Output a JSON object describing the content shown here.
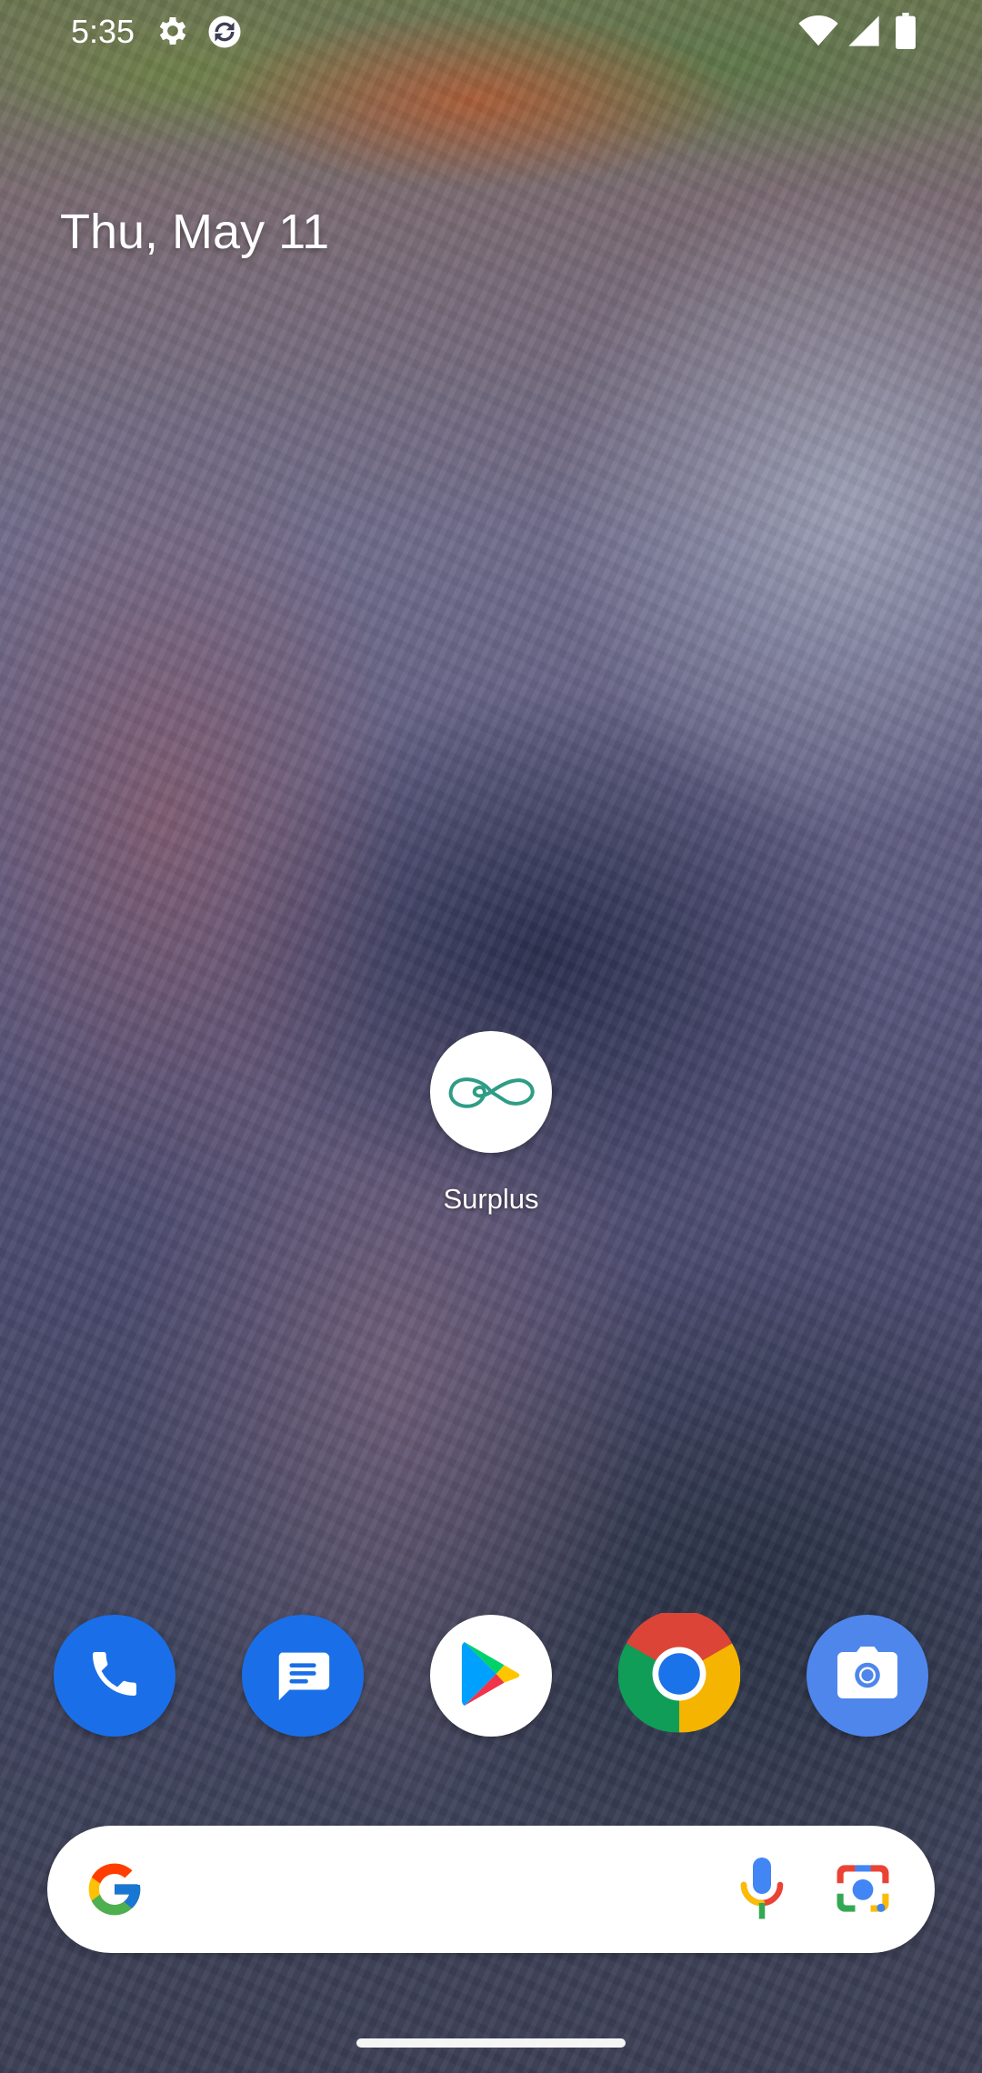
{
  "status_bar": {
    "time": "5:35",
    "icons": [
      "gear-icon",
      "sync-icon",
      "wifi-icon",
      "signal-icon",
      "battery-icon"
    ]
  },
  "home": {
    "date": "Thu, May 11",
    "apps": [
      {
        "label": "Surplus",
        "icon": "surplus-infinity-icon",
        "accent": "#2f9c86"
      }
    ]
  },
  "dock": {
    "apps": [
      {
        "name": "Phone",
        "icon": "phone-icon",
        "color": "#1a6fe8"
      },
      {
        "name": "Messages",
        "icon": "messages-icon",
        "color": "#1a6fe8"
      },
      {
        "name": "Play Store",
        "icon": "play-store-icon",
        "color": "#ffffff"
      },
      {
        "name": "Chrome",
        "icon": "chrome-icon",
        "color": "#1a73e8"
      },
      {
        "name": "Camera",
        "icon": "camera-icon",
        "color": "#4f86ec"
      }
    ]
  },
  "search": {
    "icons": [
      "google-g-icon",
      "mic-icon",
      "lens-icon"
    ]
  },
  "colors": {
    "google_blue": "#4285F4",
    "google_red": "#EA4335",
    "google_yellow": "#FBBC05",
    "google_green": "#34A853"
  }
}
